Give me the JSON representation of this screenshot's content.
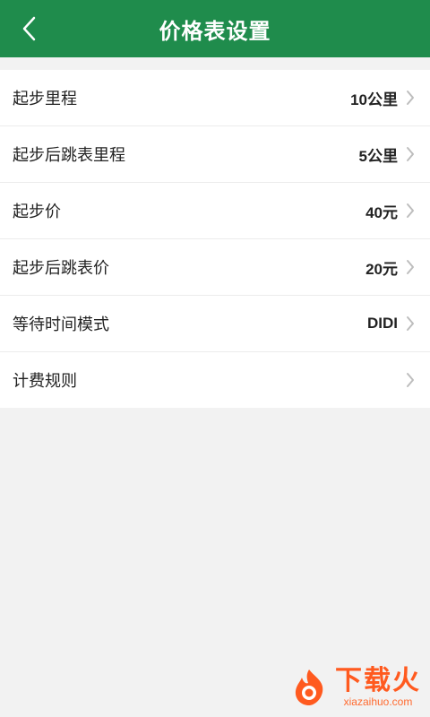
{
  "header": {
    "title": "价格表设置"
  },
  "settings": {
    "items": [
      {
        "label": "起步里程",
        "value": "10公里"
      },
      {
        "label": "起步后跳表里程",
        "value": "5公里"
      },
      {
        "label": "起步价",
        "value": "40元"
      },
      {
        "label": "起步后跳表价",
        "value": "20元"
      },
      {
        "label": "等待时间模式",
        "value": "DIDI"
      },
      {
        "label": "计费规则",
        "value": ""
      }
    ]
  },
  "watermark": {
    "main": "下载火",
    "sub": "xiazaihuo.com"
  },
  "colors": {
    "header_bg": "#1f8c4c",
    "page_bg": "#f2f2f2",
    "chevron": "#bdbdbd",
    "watermark": "#ff5a1f"
  },
  "icons": {
    "back": "chevron-left-icon",
    "row_arrow": "chevron-right-icon"
  }
}
